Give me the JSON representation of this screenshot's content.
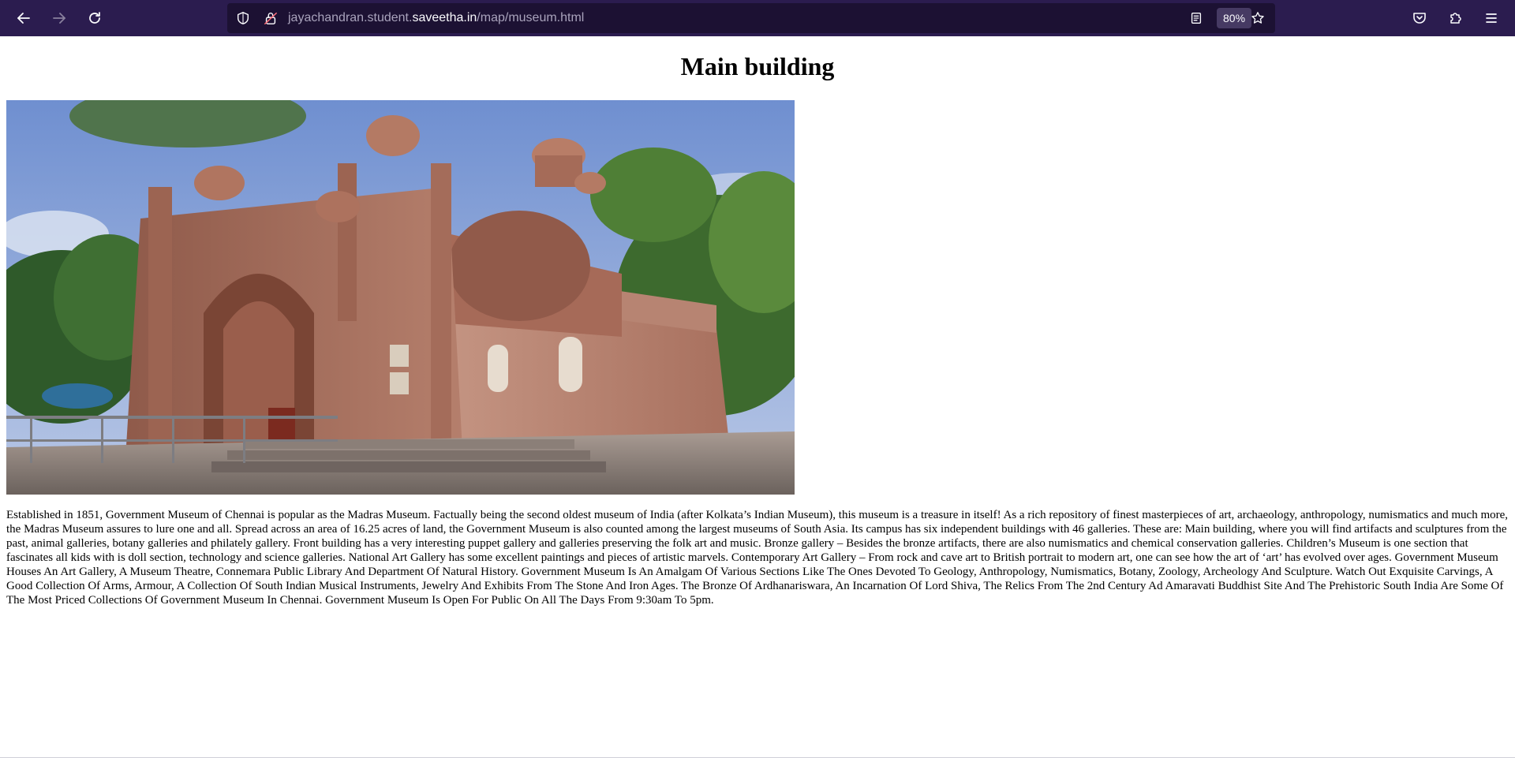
{
  "browser": {
    "url_prefix": "jayachandran.student.",
    "url_host": "saveetha.in",
    "url_path": "/map/museum.html",
    "zoom": "80%",
    "icons": {
      "back": "back-arrow-icon",
      "forward": "forward-arrow-icon",
      "reload": "reload-icon",
      "shield": "tracking-protection-shield-icon",
      "lock": "insecure-lock-icon",
      "reader": "reader-view-icon",
      "bookmark": "bookmark-star-icon",
      "pocket": "pocket-icon",
      "extensions": "extensions-puzzle-icon",
      "menu": "hamburger-menu-icon"
    },
    "colors": {
      "toolbar": "#2b1c4f",
      "urlbar": "#1c1133"
    }
  },
  "page": {
    "title": "Main building",
    "image_subject": "museum-building-photo",
    "body": "Established in 1851, Government Museum of Chennai is popular as the Madras Museum. Factually being the second oldest museum of India (after Kolkata’s Indian Museum), this museum is a treasure in itself! As a rich repository of finest masterpieces of art, archaeology, anthropology, numismatics and much more, the Madras Museum assures to lure one and all. Spread across an area of 16.25 acres of land, the Government Museum is also counted among the largest museums of South Asia. Its campus has six independent buildings with 46 galleries. These are: Main building, where you will find artifacts and sculptures from the past, animal galleries, botany galleries and philately gallery. Front building has a very interesting puppet gallery and galleries preserving the folk art and music. Bronze gallery – Besides the bronze artifacts, there are also numismatics and chemical conservation galleries. Children’s Museum is one section that fascinates all kids with is doll section, technology and science galleries. National Art Gallery has some excellent paintings and pieces of artistic marvels. Contemporary Art Gallery – From rock and cave art to British portrait to modern art, one can see how the art of ‘art’ has evolved over ages. Government Museum Houses An Art Gallery, A Museum Theatre, Connemara Public Library And Department Of Natural History. Government Museum Is An Amalgam Of Various Sections Like The Ones Devoted To Geology, Anthropology, Numismatics, Botany, Zoology, Archeology And Sculpture. Watch Out Exquisite Carvings, A Good Collection Of Arms, Armour, A Collection Of South Indian Musical Instruments, Jewelry And Exhibits From The Stone And Iron Ages. The Bronze Of Ardhanariswara, An Incarnation Of Lord Shiva, The Relics From The 2nd Century Ad Amaravati Buddhist Site And The Prehistoric South India Are Some Of The Most Priced Collections Of Government Museum In Chennai. Government Museum Is Open For Public On All The Days From 9:30am To 5pm."
  }
}
